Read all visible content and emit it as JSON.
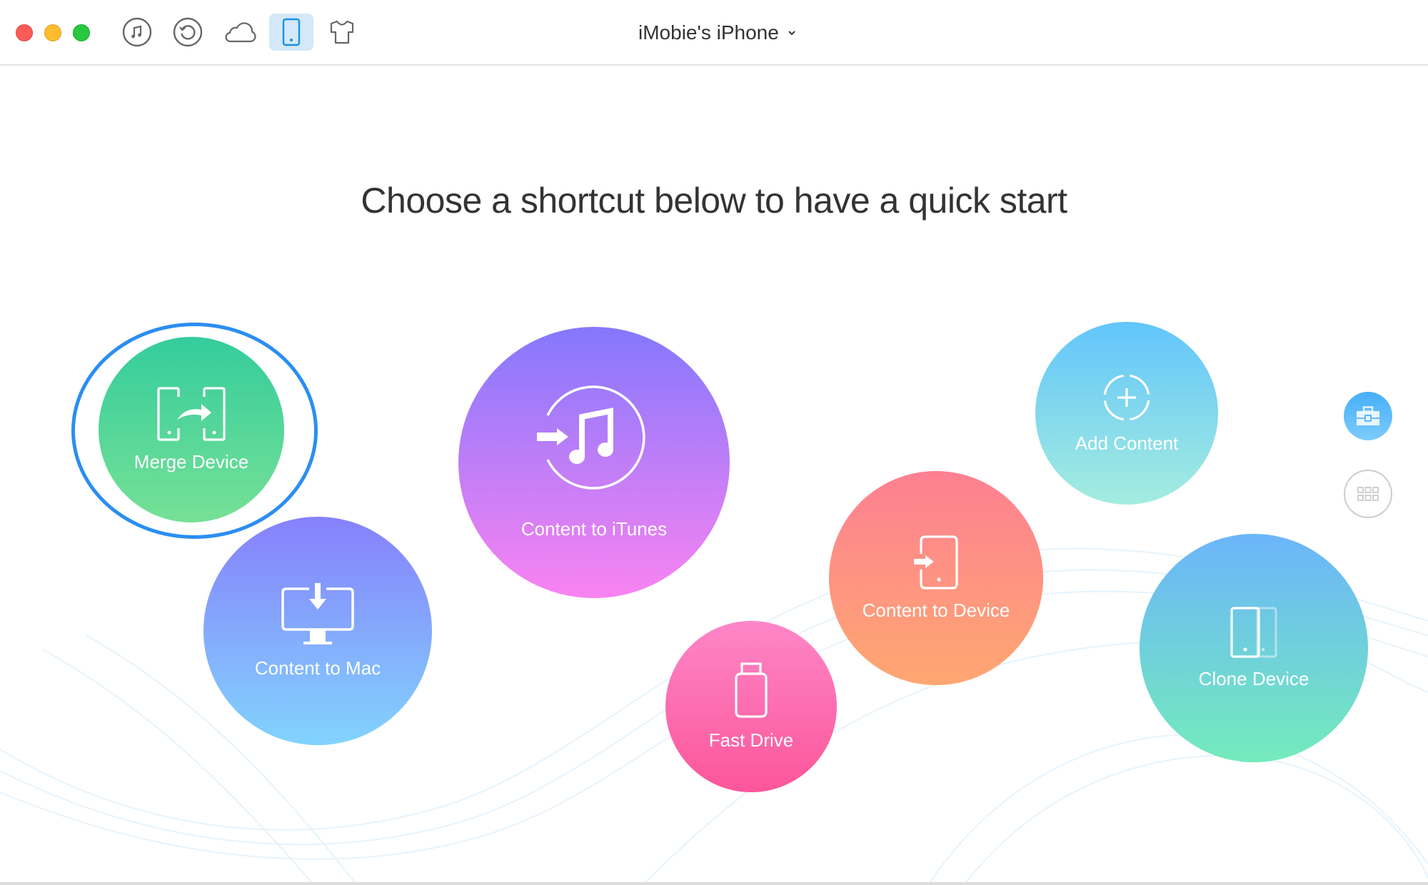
{
  "window": {
    "controls": [
      "close",
      "minimize",
      "zoom"
    ],
    "device_name": "iMobie's iPhone",
    "device_dropdown_icon": "chevron-down-icon"
  },
  "toolbar": {
    "items": [
      {
        "name": "itunes-library",
        "icon": "music-note-icon",
        "active": false
      },
      {
        "name": "backup-restore",
        "icon": "restore-icon",
        "active": false
      },
      {
        "name": "icloud",
        "icon": "cloud-icon",
        "active": false
      },
      {
        "name": "device",
        "icon": "phone-icon",
        "active": true
      },
      {
        "name": "skin-theme",
        "icon": "shirt-icon",
        "active": false
      }
    ],
    "active_color": "#1a8fe3",
    "active_bg": "#d3e8f8"
  },
  "main": {
    "heading": "Choose a shortcut below to have a quick start",
    "shortcuts": [
      {
        "label": "Merge Device",
        "icon": "merge-device-icon",
        "selected": true,
        "colors": [
          "#34cc9c",
          "#76e196"
        ]
      },
      {
        "label": "Content to Mac",
        "icon": "monitor-download-icon",
        "selected": false,
        "colors": [
          "#8680fc",
          "#82d3fd"
        ]
      },
      {
        "label": "Content to iTunes",
        "icon": "itunes-import-icon",
        "selected": false,
        "colors": [
          "#8478fd",
          "#f983f1"
        ]
      },
      {
        "label": "Fast Drive",
        "icon": "usb-drive-icon",
        "selected": false,
        "colors": [
          "#fd86c8",
          "#fc5699"
        ]
      },
      {
        "label": "Content to Device",
        "icon": "phone-import-icon",
        "selected": false,
        "colors": [
          "#fd8092",
          "#fea771"
        ]
      },
      {
        "label": "Add Content",
        "icon": "add-circle-icon",
        "selected": false,
        "colors": [
          "#62c5fb",
          "#a4ecdf"
        ]
      },
      {
        "label": "Clone Device",
        "icon": "clone-device-icon",
        "selected": false,
        "colors": [
          "#6bb5fa",
          "#74ebbc"
        ]
      }
    ],
    "selection_ring_color": "#2b8ef0"
  },
  "side_buttons": [
    {
      "name": "toolbox",
      "icon": "toolbox-icon",
      "active": true
    },
    {
      "name": "app-grid",
      "icon": "grid-icon",
      "active": false
    }
  ]
}
